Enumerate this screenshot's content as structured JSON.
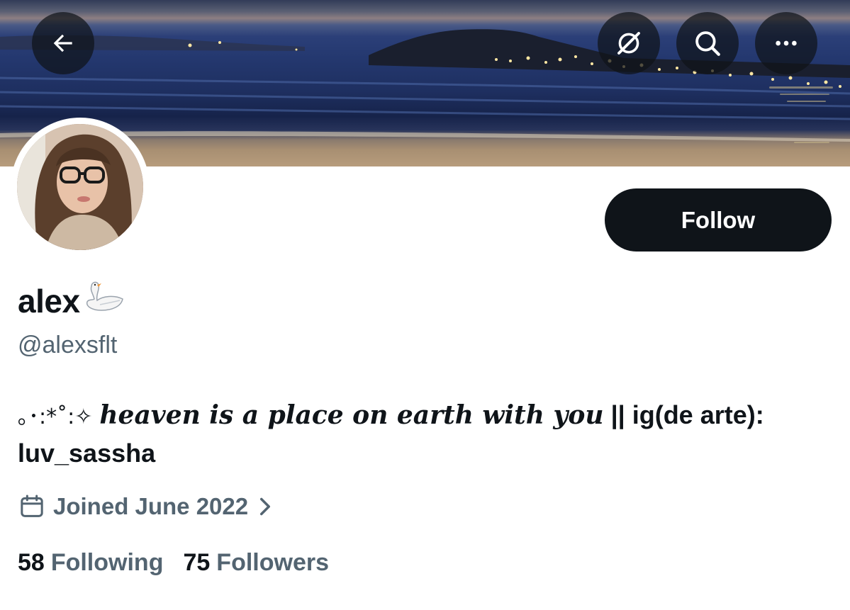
{
  "header": {
    "icons": [
      "back-arrow-icon",
      "grok-icon",
      "search-icon",
      "more-icon"
    ]
  },
  "profile": {
    "display_name": "alex",
    "name_emoji": "🦢",
    "handle": "@alexsflt",
    "bio": {
      "symbols": "｡･:*˚:✧",
      "fancy_text": "heaven is a place on earth with you",
      "plain_text": "|| ig(de arte): luv_sassha"
    },
    "joined": "Joined June 2022",
    "following_count": "58",
    "following_label": "Following",
    "followers_count": "75",
    "followers_label": "Followers"
  },
  "actions": {
    "follow_label": "Follow"
  },
  "colors": {
    "primary_text": "#0f1419",
    "secondary_text": "#536471",
    "follow_bg": "#0f1419",
    "background": "#ffffff"
  }
}
